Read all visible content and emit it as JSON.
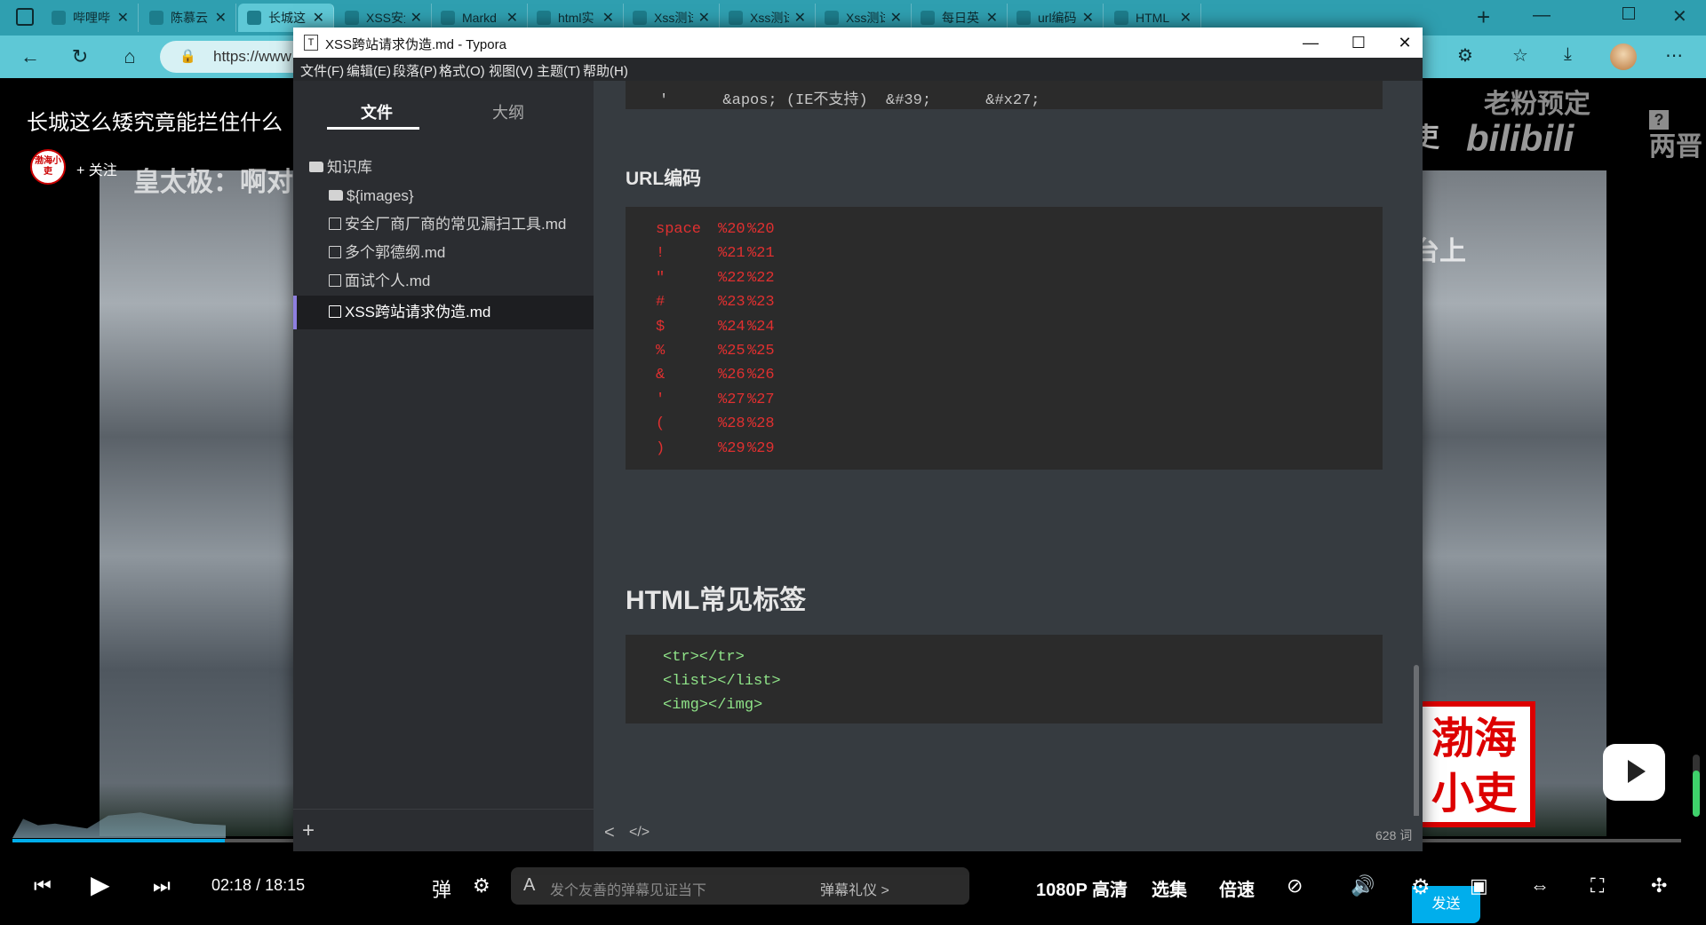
{
  "browser": {
    "tabs": [
      {
        "label": "哔哩哔"
      },
      {
        "label": "陈慕云"
      },
      {
        "label": "长城这",
        "active": true
      },
      {
        "label": "XSS安全"
      },
      {
        "label": "Markd"
      },
      {
        "label": "html实"
      },
      {
        "label": "Xss测试"
      },
      {
        "label": "Xss测试"
      },
      {
        "label": "Xss测试"
      },
      {
        "label": "每日英"
      },
      {
        "label": "url编码"
      },
      {
        "label": "HTML"
      }
    ],
    "new_tab": "+",
    "url": "https://www",
    "accent": "#5ec8d6"
  },
  "video": {
    "title": "长城这么矮究竟能拦住什么",
    "follow": "+ 关注",
    "uploader_badge": "渤海小吏",
    "subtitle_left": "皇太极：啊对",
    "subtitle_right": "台上",
    "subtitle_right_top": "吏",
    "watermark_top": "老粉预定",
    "watermark_logo": "bilibili",
    "corner_text": "两晋",
    "seal_text": "渤海\n小吏",
    "progress": 0.127,
    "current_time": "02:18",
    "time_separator": "/",
    "duration": "18:15",
    "danmaku_placeholder": "发个友善的弹幕见证当下",
    "danmaku_gift": "弹幕礼仪 >",
    "send": "发送",
    "quality": "1080P 高清",
    "episodes": "选集",
    "speed": "倍速"
  },
  "typora": {
    "title": "XSS跨站请求伪造.md - Typora",
    "app_icon": "T",
    "menus": [
      "文件(F)",
      "编辑(E)",
      "段落(P)",
      "格式(O)",
      "视图(V)",
      "主题(T)",
      "帮助(H)"
    ],
    "sidebar": {
      "tab_files": "文件",
      "tab_outline": "大纲",
      "tree": [
        {
          "label": "知识库",
          "type": "folder"
        },
        {
          "label": "${images}",
          "type": "folder"
        },
        {
          "label": "安全厂商厂商的常见漏扫工具.md",
          "type": "file"
        },
        {
          "label": "多个郭德纲.md",
          "type": "file"
        },
        {
          "label": "面试个人.md",
          "type": "file"
        },
        {
          "label": "XSS跨站请求伪造.md",
          "type": "file",
          "selected": true
        }
      ],
      "add": "+"
    },
    "editor": {
      "top_code_line": "'      &apos; (IE不支持)  &#39;      &#x27;",
      "h_url": "URL编码",
      "url_table": [
        {
          "char": "space",
          "a": "%20",
          "b": "%20"
        },
        {
          "char": "!",
          "a": "%21",
          "b": "%21"
        },
        {
          "char": "\"",
          "a": "%22",
          "b": "%22"
        },
        {
          "char": "#",
          "a": "%23",
          "b": "%23"
        },
        {
          "char": "$",
          "a": "%24",
          "b": "%24"
        },
        {
          "char": "%",
          "a": "%25",
          "b": "%25"
        },
        {
          "char": "&",
          "a": "%26",
          "b": "%26"
        },
        {
          "char": "'",
          "a": "%27",
          "b": "%27"
        },
        {
          "char": "(",
          "a": "%28",
          "b": "%28"
        },
        {
          "char": ")",
          "a": "%29",
          "b": "%29"
        }
      ],
      "h_html": "HTML常见标签",
      "html_lines": [
        "<tr></tr>",
        "<list></list>",
        "<img></img>"
      ]
    },
    "status": {
      "back": "<",
      "source": "</>",
      "words": "628 词"
    }
  }
}
